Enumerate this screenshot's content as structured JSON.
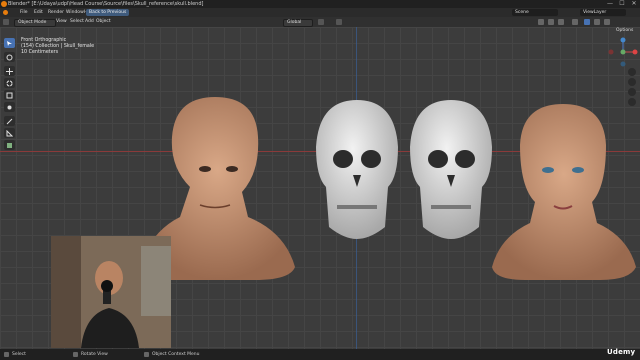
{
  "window": {
    "title": "Blender* [E:\\Udaya\\udpl\\Head Course\\Source\\files\\Skull_reference\\skull.blend]",
    "controls": [
      "—",
      "☐",
      "✕"
    ]
  },
  "menubar": {
    "items": [
      "File",
      "Edit",
      "Render",
      "Window",
      "Help"
    ],
    "back_button": "Back to Previous",
    "scene_label": "Scene",
    "view_layer_label": "ViewLayer"
  },
  "header": {
    "mode": "Object Mode",
    "menus": [
      "View",
      "Select",
      "Add",
      "Object"
    ],
    "transform": "Global",
    "options_label": "Options"
  },
  "viewport": {
    "overlay_lines": [
      "Front Orthographic",
      "(154) Collection | Skull_female",
      "10 Centimeters"
    ]
  },
  "statusbar": {
    "select": "Select",
    "rotate": "Rotate View",
    "context": "Object Context Menu"
  },
  "branding": {
    "watermark": "Udemy"
  },
  "colors": {
    "accent": "#4772b3",
    "x_axis": "#8a3a3a",
    "y_axis": "#3a5a8a",
    "blender_orange": "#e87d0d"
  }
}
